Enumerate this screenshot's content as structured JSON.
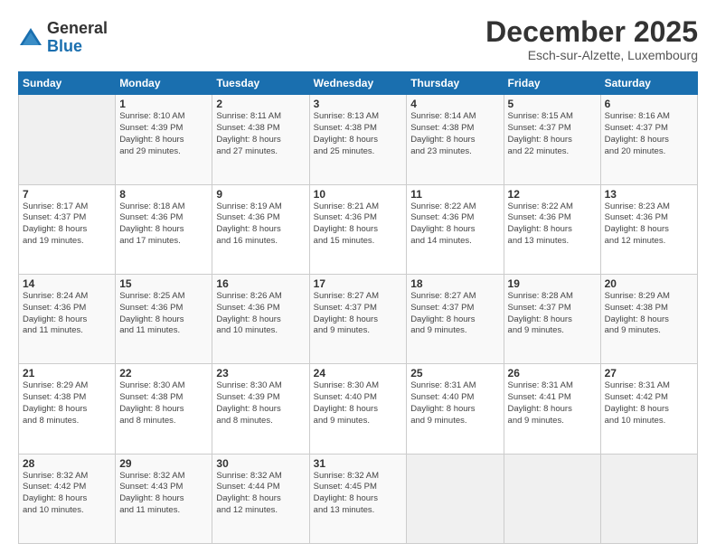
{
  "logo": {
    "general": "General",
    "blue": "Blue"
  },
  "title": "December 2025",
  "location": "Esch-sur-Alzette, Luxembourg",
  "header_days": [
    "Sunday",
    "Monday",
    "Tuesday",
    "Wednesday",
    "Thursday",
    "Friday",
    "Saturday"
  ],
  "weeks": [
    [
      {
        "day": "",
        "info": ""
      },
      {
        "day": "1",
        "info": "Sunrise: 8:10 AM\nSunset: 4:39 PM\nDaylight: 8 hours\nand 29 minutes."
      },
      {
        "day": "2",
        "info": "Sunrise: 8:11 AM\nSunset: 4:38 PM\nDaylight: 8 hours\nand 27 minutes."
      },
      {
        "day": "3",
        "info": "Sunrise: 8:13 AM\nSunset: 4:38 PM\nDaylight: 8 hours\nand 25 minutes."
      },
      {
        "day": "4",
        "info": "Sunrise: 8:14 AM\nSunset: 4:38 PM\nDaylight: 8 hours\nand 23 minutes."
      },
      {
        "day": "5",
        "info": "Sunrise: 8:15 AM\nSunset: 4:37 PM\nDaylight: 8 hours\nand 22 minutes."
      },
      {
        "day": "6",
        "info": "Sunrise: 8:16 AM\nSunset: 4:37 PM\nDaylight: 8 hours\nand 20 minutes."
      }
    ],
    [
      {
        "day": "7",
        "info": "Sunrise: 8:17 AM\nSunset: 4:37 PM\nDaylight: 8 hours\nand 19 minutes."
      },
      {
        "day": "8",
        "info": "Sunrise: 8:18 AM\nSunset: 4:36 PM\nDaylight: 8 hours\nand 17 minutes."
      },
      {
        "day": "9",
        "info": "Sunrise: 8:19 AM\nSunset: 4:36 PM\nDaylight: 8 hours\nand 16 minutes."
      },
      {
        "day": "10",
        "info": "Sunrise: 8:21 AM\nSunset: 4:36 PM\nDaylight: 8 hours\nand 15 minutes."
      },
      {
        "day": "11",
        "info": "Sunrise: 8:22 AM\nSunset: 4:36 PM\nDaylight: 8 hours\nand 14 minutes."
      },
      {
        "day": "12",
        "info": "Sunrise: 8:22 AM\nSunset: 4:36 PM\nDaylight: 8 hours\nand 13 minutes."
      },
      {
        "day": "13",
        "info": "Sunrise: 8:23 AM\nSunset: 4:36 PM\nDaylight: 8 hours\nand 12 minutes."
      }
    ],
    [
      {
        "day": "14",
        "info": "Sunrise: 8:24 AM\nSunset: 4:36 PM\nDaylight: 8 hours\nand 11 minutes."
      },
      {
        "day": "15",
        "info": "Sunrise: 8:25 AM\nSunset: 4:36 PM\nDaylight: 8 hours\nand 11 minutes."
      },
      {
        "day": "16",
        "info": "Sunrise: 8:26 AM\nSunset: 4:36 PM\nDaylight: 8 hours\nand 10 minutes."
      },
      {
        "day": "17",
        "info": "Sunrise: 8:27 AM\nSunset: 4:37 PM\nDaylight: 8 hours\nand 9 minutes."
      },
      {
        "day": "18",
        "info": "Sunrise: 8:27 AM\nSunset: 4:37 PM\nDaylight: 8 hours\nand 9 minutes."
      },
      {
        "day": "19",
        "info": "Sunrise: 8:28 AM\nSunset: 4:37 PM\nDaylight: 8 hours\nand 9 minutes."
      },
      {
        "day": "20",
        "info": "Sunrise: 8:29 AM\nSunset: 4:38 PM\nDaylight: 8 hours\nand 9 minutes."
      }
    ],
    [
      {
        "day": "21",
        "info": "Sunrise: 8:29 AM\nSunset: 4:38 PM\nDaylight: 8 hours\nand 8 minutes."
      },
      {
        "day": "22",
        "info": "Sunrise: 8:30 AM\nSunset: 4:38 PM\nDaylight: 8 hours\nand 8 minutes."
      },
      {
        "day": "23",
        "info": "Sunrise: 8:30 AM\nSunset: 4:39 PM\nDaylight: 8 hours\nand 8 minutes."
      },
      {
        "day": "24",
        "info": "Sunrise: 8:30 AM\nSunset: 4:40 PM\nDaylight: 8 hours\nand 9 minutes."
      },
      {
        "day": "25",
        "info": "Sunrise: 8:31 AM\nSunset: 4:40 PM\nDaylight: 8 hours\nand 9 minutes."
      },
      {
        "day": "26",
        "info": "Sunrise: 8:31 AM\nSunset: 4:41 PM\nDaylight: 8 hours\nand 9 minutes."
      },
      {
        "day": "27",
        "info": "Sunrise: 8:31 AM\nSunset: 4:42 PM\nDaylight: 8 hours\nand 10 minutes."
      }
    ],
    [
      {
        "day": "28",
        "info": "Sunrise: 8:32 AM\nSunset: 4:42 PM\nDaylight: 8 hours\nand 10 minutes."
      },
      {
        "day": "29",
        "info": "Sunrise: 8:32 AM\nSunset: 4:43 PM\nDaylight: 8 hours\nand 11 minutes."
      },
      {
        "day": "30",
        "info": "Sunrise: 8:32 AM\nSunset: 4:44 PM\nDaylight: 8 hours\nand 12 minutes."
      },
      {
        "day": "31",
        "info": "Sunrise: 8:32 AM\nSunset: 4:45 PM\nDaylight: 8 hours\nand 13 minutes."
      },
      {
        "day": "",
        "info": ""
      },
      {
        "day": "",
        "info": ""
      },
      {
        "day": "",
        "info": ""
      }
    ]
  ]
}
